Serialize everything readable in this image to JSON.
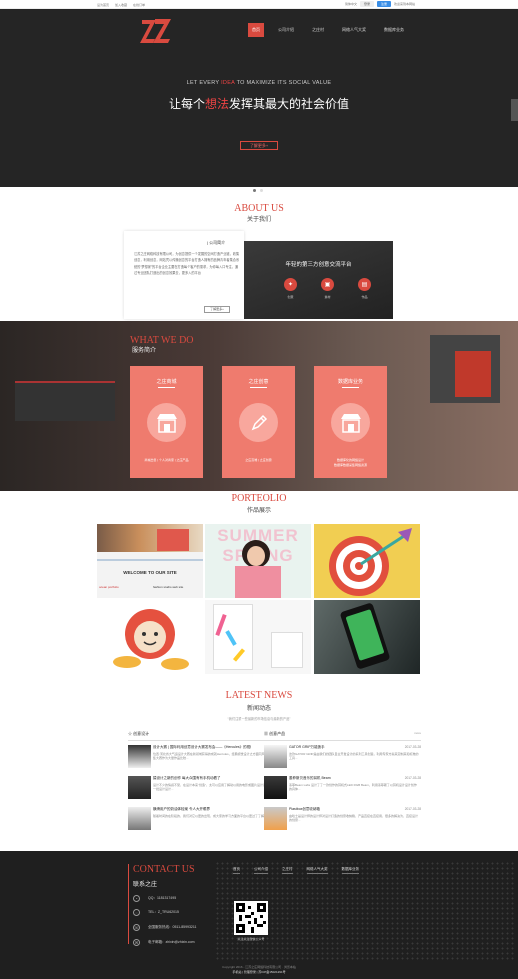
{
  "topbar": {
    "links": [
      "设为首页",
      "加入收藏",
      "在线订单"
    ],
    "lang": "简体中文",
    "login": "登录",
    "register": "注册",
    "hint": "欢迎来到本网站"
  },
  "nav": [
    "首页",
    "公司介绍",
    "之庄村",
    "网络人气大奖",
    "数据库业务"
  ],
  "hero": {
    "en_pre": "LET EVERY ",
    "en_hl": "IDEA",
    "en_post": " TO MAXIMIZE ITS SOCIAL VALUE",
    "cn_pre": "让每个",
    "cn_hl": "想法",
    "cn_post": "发挥其最大的社会价值",
    "button": "了解更多+"
  },
  "about": {
    "en": "ABOUT US",
    "cn": "关于我们",
    "card_heading": "| 公司简介",
    "card_text": "江苏之庄网络科技有限公司，为创意提供一个发展的空间打造产业链，收集创意，利用创意，网站凭以传播创意的平台打造人拥有的品牌青年者集合系统的“梦想家”的平台企业主要在打造每个客户的需求，为你每入口专注，通过专业团队打造出的创意效果去，更多入的平台",
    "more": "了解更多+",
    "right_title": "年轻的第三方创意交流平台",
    "icons": [
      {
        "label": "创意",
        "icon": "bulb-icon",
        "glyph": "✦"
      },
      {
        "label": "素材",
        "icon": "image-icon",
        "glyph": "▣"
      },
      {
        "label": "作品",
        "icon": "cart-icon",
        "glyph": "▤"
      }
    ]
  },
  "services": {
    "en": "WHAT WE DO",
    "cn": "服务简介",
    "cards": [
      {
        "title": "之庄商城",
        "sub": "商城出售  |  个人对商家  |  之庄产品"
      },
      {
        "title": "之庄创意",
        "sub": "之庄高端  |  之庄创意"
      },
      {
        "title": "数据库业务",
        "sub": "数据库化的网络设计\n数据库数据采集网络资源"
      }
    ]
  },
  "portfolio": {
    "en": "PORTEOLIO",
    "cn": "作品展示",
    "items": [
      {
        "caption": "WELCOME TO OUR SITE",
        "sub_left": "ocean portfolio",
        "sub_right": "fashion studio web site"
      },
      {
        "caption": "SUMMER SPRING"
      },
      {
        "caption": ""
      },
      {
        "caption": ""
      },
      {
        "caption": ""
      },
      {
        "caption": ""
      }
    ]
  },
  "news": {
    "en": "LATEST NEWS",
    "cn": "新闻动态",
    "sub": "“我们注重一些最新的市场信息与最新的产品”",
    "left": {
      "title": "创意设计",
      "more": "more",
      "items": [
        {
          "title": "设计大赛 | 国际利用创意设计大赛发布会——《Hercules》的视线",
          "date": "2016-03-25",
          "desc": "位置:河北省大气运设计大赛在新领域获得的成就Hercules，经典视觉设计之方面同风格。 更多搜集大赛作为大量作品比较..."
        },
        {
          "title": "猿设计之新的创作 每大众围有有手机动看了",
          "date": "2017-03-28",
          "desc": "设计不少的情感不受，在设计本来“创造”，太可以应用了解动以用的电影或图片设计说起，其中有一批设计设计..."
        },
        {
          "title": "横滑用户的奶油体检案 令人大开眼界",
          "date": "2017-03-28",
          "desc": "随着时间的在阶段的，我们对它以更的出现，成大家的学习方面的平台以更过了了解中有设计..."
        }
      ]
    },
    "right": {
      "title": "创意产品",
      "more": "more",
      "items": [
        {
          "title": "GATOR GRIP万能扳手",
          "date": "2017-03-28",
          "desc": "这款GATOR GRIP是由我们的团队自主开发设计的系列工具创造，利用专家方案来定制来和标准的工具..."
        },
        {
          "title": "墨菲斯贝音乐的耳机 Beam",
          "date": "2017-03-28",
          "desc": "墨菲Beam Labs 设计了了一款创作的耳机式LED RGB Beam，利用墨菲斯了以耳机设计设计创作的具体..."
        },
        {
          "title": "Plastbox创意收纳箱",
          "date": "2017-03-28",
          "desc": "由哈士是设计师的设计师对设计打造的创意收纳箱，产品直接在直接用，很多的解决为，直接设计的创意..."
        }
      ]
    }
  },
  "footer": {
    "en": "CONTACT US",
    "cn": "联系之庄",
    "qq": "QQ：1181317495",
    "tel": "TEL：Z_TRU62015",
    "phone": "全国服务热线：0511-85993211",
    "email": "电子邮箱：zhixin@zhixin.com",
    "nav": [
      "首页",
      "公司介绍",
      "之庄村",
      "网络人气大奖",
      "数据库业务"
    ],
    "qr_caption": "关注关注微信公众号",
    "copyright": "Copyright 2016 - 江苏之庄网络科技有限公司  ·  浏览本站",
    "icp": "手机站 | 管理登录 | 苏ICP备15021291号"
  }
}
